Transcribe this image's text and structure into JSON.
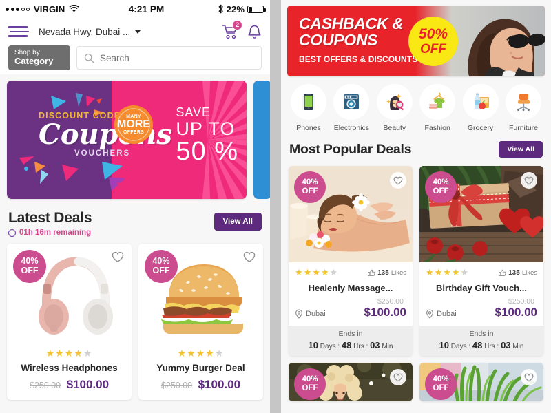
{
  "status_bar": {
    "carrier": "VIRGIN",
    "signal_filled": 3,
    "signal_total": 5,
    "time": "4:21 PM",
    "battery_percent": "22%",
    "battery_level": 22,
    "bluetooth_icon": "bluetooth-icon",
    "wifi_icon": "wifi-icon"
  },
  "nav": {
    "menu_icon": "hamburger-menu-icon",
    "location": "Nevada Hwy, Dubai ...",
    "cart_icon": "shopping-cart-icon",
    "cart_count": "2",
    "bell_icon": "notification-bell-icon"
  },
  "search": {
    "shop_by_line1": "Shop by",
    "shop_by_line2": "Category",
    "placeholder": "Search",
    "value": "",
    "search_icon": "search-icon"
  },
  "hero_banner": {
    "eyebrow": "DISCOUNT CODES",
    "headline": "Coupons",
    "subline": "VOUCHERS",
    "seal_top": "MANY",
    "seal_mid": "MORE",
    "seal_bottom": "OFFERS",
    "save_l1": "SAVE",
    "save_l2": "UP TO",
    "save_l3": "50 %",
    "purple": "#6b3283",
    "pink": "#ef2a7b",
    "gold": "#f0b43c",
    "next_slide_color": "#2f8fd4"
  },
  "latest_deals": {
    "title": "Latest Deals",
    "timer": "01h 16m remaining",
    "timer_icon": "clock-icon",
    "view_all": "View All",
    "products": [
      {
        "badge_l1": "40%",
        "badge_l2": "OFF",
        "heart_icon": "heart-outline-icon",
        "rating": 4,
        "name": "Wireless Headphones",
        "old_price": "$250.00",
        "new_price": "$100.00",
        "image": "rose-gold-wireless-headphones"
      },
      {
        "badge_l1": "40%",
        "badge_l2": "OFF",
        "heart_icon": "heart-outline-icon",
        "rating": 4,
        "name": "Yummy Burger Deal",
        "old_price": "$250.00",
        "new_price": "$100.00",
        "image": "cheeseburger"
      }
    ]
  },
  "cashback_banner": {
    "line1": "CASHBACK &",
    "line2": "COUPONS",
    "sub": "BEST OFFERS & DISCOUNTS",
    "circle_l1": "50%",
    "circle_l2": "OFF",
    "red": "#e8232a",
    "yellow": "#f9e814",
    "image": "woman-with-sunglasses"
  },
  "categories": [
    {
      "label": "Phones",
      "icon": "smartphone-icon"
    },
    {
      "label": "Electronics",
      "icon": "washing-machine-icon"
    },
    {
      "label": "Beauty",
      "icon": "woman-with-mirror-icon"
    },
    {
      "label": "Fashion",
      "icon": "tshirt-hanger-icon"
    },
    {
      "label": "Grocery",
      "icon": "groceries-icon"
    },
    {
      "label": "Furniture",
      "icon": "office-chair-icon"
    }
  ],
  "popular_deals": {
    "title": "Most Popular Deals",
    "view_all": "View All",
    "deals": [
      {
        "badge_l1": "40%",
        "badge_l2": "OFF",
        "heart_icon": "heart-outline-icon",
        "rating": 4,
        "likes_count": "135",
        "likes_label": "Likes",
        "likes_icon": "thumbs-up-icon",
        "title": "Healenly Massage...",
        "location": "Dubai",
        "location_icon": "map-pin-icon",
        "old_price": "$250.00",
        "new_price": "$100.00",
        "ends_label": "Ends in",
        "days": "10",
        "days_label": "Days",
        "hrs": "48",
        "hrs_label": "Hrs",
        "min": "03",
        "min_label": "Min",
        "image": "spa-massage-woman"
      },
      {
        "badge_l1": "40%",
        "badge_l2": "OFF",
        "heart_icon": "heart-outline-icon",
        "rating": 4,
        "likes_count": "135",
        "likes_label": "Likes",
        "likes_icon": "thumbs-up-icon",
        "title": "Birthday Gift Vouch...",
        "location": "Dubai",
        "location_icon": "map-pin-icon",
        "old_price": "$250.00",
        "new_price": "$100.00",
        "ends_label": "Ends in",
        "days": "10",
        "days_label": "Days",
        "hrs": "48",
        "hrs_label": "Hrs",
        "min": "03",
        "min_label": "Min",
        "image": "gift-box-with-red-ribbon-and-roses"
      }
    ],
    "partial_deals": [
      {
        "badge_l1": "40%",
        "badge_l2": "OFF",
        "heart_icon": "heart-outline-icon",
        "image": "curly-haired-blonde-woman"
      },
      {
        "badge_l1": "40%",
        "badge_l2": "OFF",
        "heart_icon": "heart-outline-icon",
        "image": "green-grass-plants"
      }
    ]
  },
  "theme": {
    "purple": "#5d2a7e",
    "pink": "#cc4d8f",
    "magenta": "#d6458e",
    "star_gold": "#f2c230",
    "bg": "#f7f7f7"
  }
}
